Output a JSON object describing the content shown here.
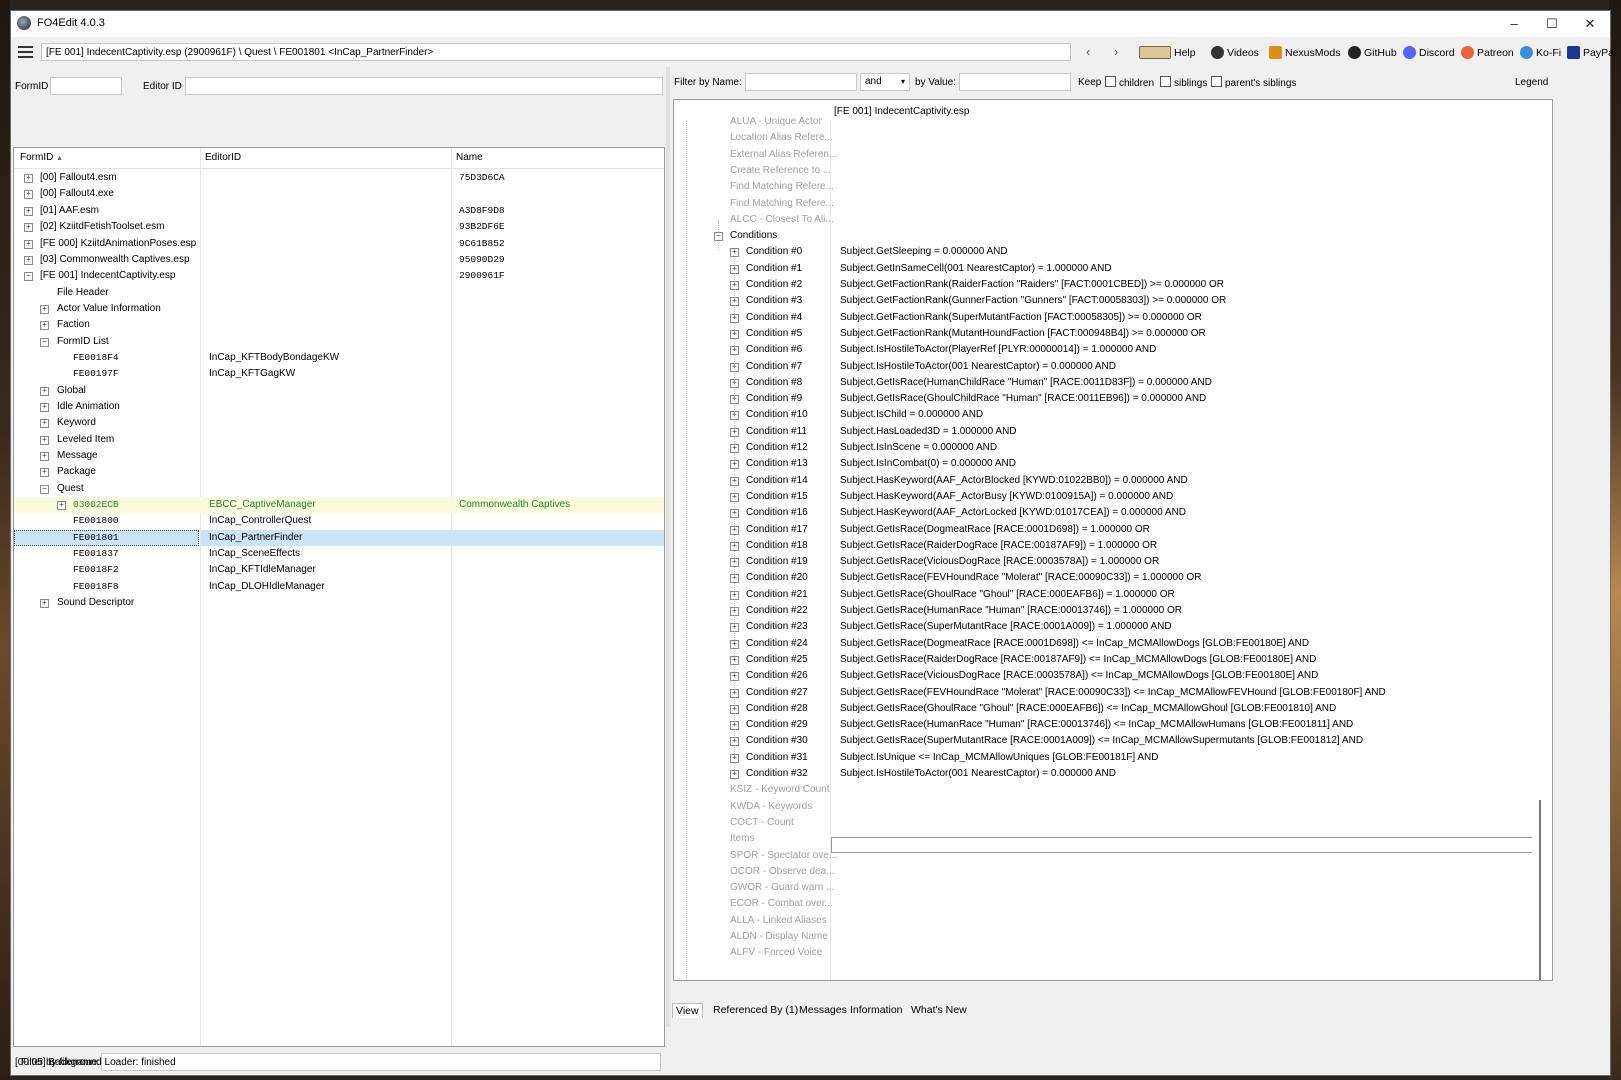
{
  "window": {
    "title": "FO4Edit 4.0.3",
    "controls": {
      "minimize": "–",
      "maximize": "☐",
      "close": "✕"
    }
  },
  "toolbar": {
    "path": "[FE 001] IndecentCaptivity.esp (2900961F) \\ Quest \\ FE001801 <InCap_PartnerFinder>",
    "back": "‹",
    "forward": "›",
    "links": [
      {
        "label": "Help",
        "icon": "book-icon"
      },
      {
        "label": "Videos",
        "icon": "video-icon"
      },
      {
        "label": "NexusMods",
        "icon": "nexusmods-icon"
      },
      {
        "label": "GitHub",
        "icon": "github-icon"
      },
      {
        "label": "Discord",
        "icon": "discord-icon"
      },
      {
        "label": "Patreon",
        "icon": "patreon-icon"
      },
      {
        "label": "Ko-Fi",
        "icon": "kofi-icon"
      },
      {
        "label": "PayPal",
        "icon": "paypal-icon"
      }
    ]
  },
  "left": {
    "formid_label": "FormID",
    "editorid_label": "Editor ID",
    "columns": {
      "formid": "FormID",
      "sort": "▲",
      "editorid": "EditorID",
      "name": "Name"
    },
    "filter_filename_label": "Filter by filename:",
    "rows": [
      {
        "id": "[00] Fallout4.esm",
        "editor": "",
        "name": "75D3D6CA"
      },
      {
        "id": "[00] Fallout4.exe",
        "editor": "",
        "name": ""
      },
      {
        "id": "[01] AAF.esm",
        "editor": "",
        "name": "A3D8F9D8"
      },
      {
        "id": "[02] KziitdFetishToolset.esm",
        "editor": "",
        "name": "93B2DF6E"
      },
      {
        "id": "[FE 000] KziitdAnimationPoses.esp",
        "editor": "",
        "name": "9C61B852"
      },
      {
        "id": "[03] Commonwealth Captives.esp",
        "editor": "",
        "name": "95090D29"
      },
      {
        "id": "[FE 001] IndecentCaptivity.esp",
        "editor": "",
        "name": "2900961F"
      },
      {
        "id": "File Header",
        "editor": "",
        "name": ""
      },
      {
        "id": "Actor Value Information",
        "editor": "",
        "name": ""
      },
      {
        "id": "Faction",
        "editor": "",
        "name": ""
      },
      {
        "id": "FormID List",
        "editor": "",
        "name": ""
      },
      {
        "id": "FE0018F4",
        "editor": "InCap_KFTBodyBondageKW",
        "name": ""
      },
      {
        "id": "FE00197F",
        "editor": "InCap_KFTGagKW",
        "name": ""
      },
      {
        "id": "Global",
        "editor": "",
        "name": ""
      },
      {
        "id": "Idle Animation",
        "editor": "",
        "name": ""
      },
      {
        "id": "Keyword",
        "editor": "",
        "name": ""
      },
      {
        "id": "Leveled Item",
        "editor": "",
        "name": ""
      },
      {
        "id": "Message",
        "editor": "",
        "name": ""
      },
      {
        "id": "Package",
        "editor": "",
        "name": ""
      },
      {
        "id": "Quest",
        "editor": "",
        "name": ""
      },
      {
        "id": "03002ECB",
        "editor": "EBCC_CaptiveManager",
        "name": "Commonwealth Captives"
      },
      {
        "id": "FE001800",
        "editor": "InCap_ControllerQuest",
        "name": ""
      },
      {
        "id": "FE001801",
        "editor": "InCap_PartnerFinder",
        "name": ""
      },
      {
        "id": "FE001837",
        "editor": "InCap_SceneEffects",
        "name": ""
      },
      {
        "id": "FE0018F2",
        "editor": "InCap_KFTIdleManager",
        "name": ""
      },
      {
        "id": "FE0018F8",
        "editor": "InCap_DLOHIdleManager",
        "name": ""
      },
      {
        "id": "Sound Descriptor",
        "editor": "",
        "name": ""
      }
    ]
  },
  "right": {
    "filter_name_label": "Filter by Name:",
    "operator": "and",
    "by_value_label": "by Value:",
    "keep_label": "Keep",
    "children_label": "children",
    "siblings_label": "siblings",
    "parents_siblings_label": "parent's siblings",
    "legend_label": "Legend",
    "column_file": "[FE 001] IndecentCaptivity.esp",
    "top_fields": [
      "ALUA - Unique Actor",
      "Location Alias Refere...",
      "External Alias Referen...",
      "Create Reference to ...",
      "Find Matching Refere...",
      "Find Matching Refere...",
      "ALCC - Closest To Ali..."
    ],
    "conditions_label": "Conditions",
    "conditions": [
      {
        "label": "Condition #0",
        "value": "Subject.GetSleeping = 0.000000 AND"
      },
      {
        "label": "Condition #1",
        "value": "Subject.GetInSameCell(001 NearestCaptor) = 1.000000 AND"
      },
      {
        "label": "Condition #2",
        "value": "Subject.GetFactionRank(RaiderFaction \"Raiders\" [FACT:0001CBED]) >= 0.000000 OR"
      },
      {
        "label": "Condition #3",
        "value": "Subject.GetFactionRank(GunnerFaction \"Gunners\" [FACT:00058303]) >= 0.000000 OR"
      },
      {
        "label": "Condition #4",
        "value": "Subject.GetFactionRank(SuperMutantFaction [FACT:00058305]) >= 0.000000 OR"
      },
      {
        "label": "Condition #5",
        "value": "Subject.GetFactionRank(MutantHoundFaction [FACT:000948B4]) >= 0.000000 OR"
      },
      {
        "label": "Condition #6",
        "value": "Subject.IsHostileToActor(PlayerRef [PLYR:00000014]) = 1.000000 AND"
      },
      {
        "label": "Condition #7",
        "value": "Subject.IsHostileToActor(001 NearestCaptor) = 0.000000 AND"
      },
      {
        "label": "Condition #8",
        "value": "Subject.GetIsRace(HumanChildRace \"Human\" [RACE:0011D83F]) = 0.000000 AND"
      },
      {
        "label": "Condition #9",
        "value": "Subject.GetIsRace(GhoulChildRace \"Human\" [RACE:0011EB96]) = 0.000000 AND"
      },
      {
        "label": "Condition #10",
        "value": "Subject.IsChild = 0.000000 AND"
      },
      {
        "label": "Condition #11",
        "value": "Subject.HasLoaded3D = 1.000000 AND"
      },
      {
        "label": "Condition #12",
        "value": "Subject.IsInScene = 0.000000 AND"
      },
      {
        "label": "Condition #13",
        "value": "Subject.IsInCombat(0) = 0.000000 AND"
      },
      {
        "label": "Condition #14",
        "value": "Subject.HasKeyword(AAF_ActorBlocked [KYWD:01022BB0]) = 0.000000 AND"
      },
      {
        "label": "Condition #15",
        "value": "Subject.HasKeyword(AAF_ActorBusy [KYWD:0100915A]) = 0.000000 AND"
      },
      {
        "label": "Condition #16",
        "value": "Subject.HasKeyword(AAF_ActorLocked [KYWD:01017CEA]) = 0.000000 AND"
      },
      {
        "label": "Condition #17",
        "value": "Subject.GetIsRace(DogmeatRace [RACE:0001D698]) = 1.000000 OR"
      },
      {
        "label": "Condition #18",
        "value": "Subject.GetIsRace(RaiderDogRace [RACE:00187AF9]) = 1.000000 OR"
      },
      {
        "label": "Condition #19",
        "value": "Subject.GetIsRace(ViciousDogRace [RACE:0003578A]) = 1.000000 OR"
      },
      {
        "label": "Condition #20",
        "value": "Subject.GetIsRace(FEVHoundRace \"Molerat\" [RACE:00090C33]) = 1.000000 OR"
      },
      {
        "label": "Condition #21",
        "value": "Subject.GetIsRace(GhoulRace \"Ghoul\" [RACE:000EAFB6]) = 1.000000 OR"
      },
      {
        "label": "Condition #22",
        "value": "Subject.GetIsRace(HumanRace \"Human\" [RACE:00013746]) = 1.000000 OR"
      },
      {
        "label": "Condition #23",
        "value": "Subject.GetIsRace(SuperMutantRace [RACE:0001A009]) = 1.000000 AND"
      },
      {
        "label": "Condition #24",
        "value": "Subject.GetIsRace(DogmeatRace [RACE:0001D698]) <= InCap_MCMAllowDogs [GLOB:FE00180E] AND"
      },
      {
        "label": "Condition #25",
        "value": "Subject.GetIsRace(RaiderDogRace [RACE:00187AF9]) <= InCap_MCMAllowDogs [GLOB:FE00180E] AND"
      },
      {
        "label": "Condition #26",
        "value": "Subject.GetIsRace(ViciousDogRace [RACE:0003578A]) <= InCap_MCMAllowDogs [GLOB:FE00180E] AND"
      },
      {
        "label": "Condition #27",
        "value": "Subject.GetIsRace(FEVHoundRace \"Molerat\" [RACE:00090C33]) <= InCap_MCMAllowFEVHound [GLOB:FE00180F] AND"
      },
      {
        "label": "Condition #28",
        "value": "Subject.GetIsRace(GhoulRace \"Ghoul\" [RACE:000EAFB6]) <= InCap_MCMAllowGhoul [GLOB:FE001810] AND"
      },
      {
        "label": "Condition #29",
        "value": "Subject.GetIsRace(HumanRace \"Human\" [RACE:00013746]) <= InCap_MCMAllowHumans [GLOB:FE001811] AND"
      },
      {
        "label": "Condition #30",
        "value": "Subject.GetIsRace(SuperMutantRace [RACE:0001A009]) <= InCap_MCMAllowSupermutants [GLOB:FE001812] AND"
      },
      {
        "label": "Condition #31",
        "value": "Subject.IsUnique <= InCap_MCMAllowUniques [GLOB:FE00181F] AND"
      },
      {
        "label": "Condition #32",
        "value": "Subject.IsHostileToActor(001 NearestCaptor) = 0.000000 AND"
      }
    ],
    "bottom_fields": [
      "KSIZ - Keyword Count",
      "KWDA - Keywords",
      "COCT - Count",
      "Items",
      "SPOR - Spectator ove...",
      "OCOR - Observe dea...",
      "GWOR - Guard warn ...",
      "ECOR - Combat over...",
      "ALLA - Linked Aliases",
      "ALDN - Display Name",
      "ALFV - Forced Voice"
    ],
    "tabs": [
      "View",
      "Referenced By (1)",
      "Messages",
      "Information",
      "What's New"
    ]
  },
  "status": {
    "text": "[00:05] Background Loader: finished"
  }
}
